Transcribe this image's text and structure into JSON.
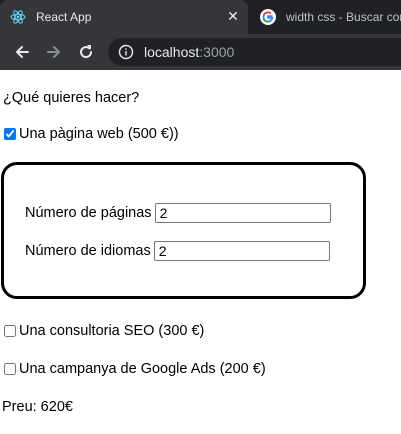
{
  "browser": {
    "tabs": [
      {
        "title": "React App",
        "active": true,
        "icon": "react-icon"
      },
      {
        "title": "width css - Buscar con",
        "active": false,
        "icon": "google-icon"
      }
    ],
    "close_glyph": "✕",
    "url": {
      "host": "localhost",
      "port": ":3000"
    }
  },
  "form": {
    "question": "¿Qué quieres hacer?",
    "web": {
      "label": "Una pàgina web (500 €))",
      "checked": true
    },
    "pages": {
      "label": "Número de páginas",
      "value": "2"
    },
    "languages": {
      "label": "Número de idiomas",
      "value": "2"
    },
    "seo": {
      "label": "Una consultoria SEO (300 €)",
      "checked": false
    },
    "ads": {
      "label": "Una campanya de Google Ads (200 €)",
      "checked": false
    },
    "total": "Preu: 620€"
  },
  "colors": {
    "tabstrip": "#202124",
    "toolbar": "#35363a",
    "accent": "#0075ff"
  }
}
